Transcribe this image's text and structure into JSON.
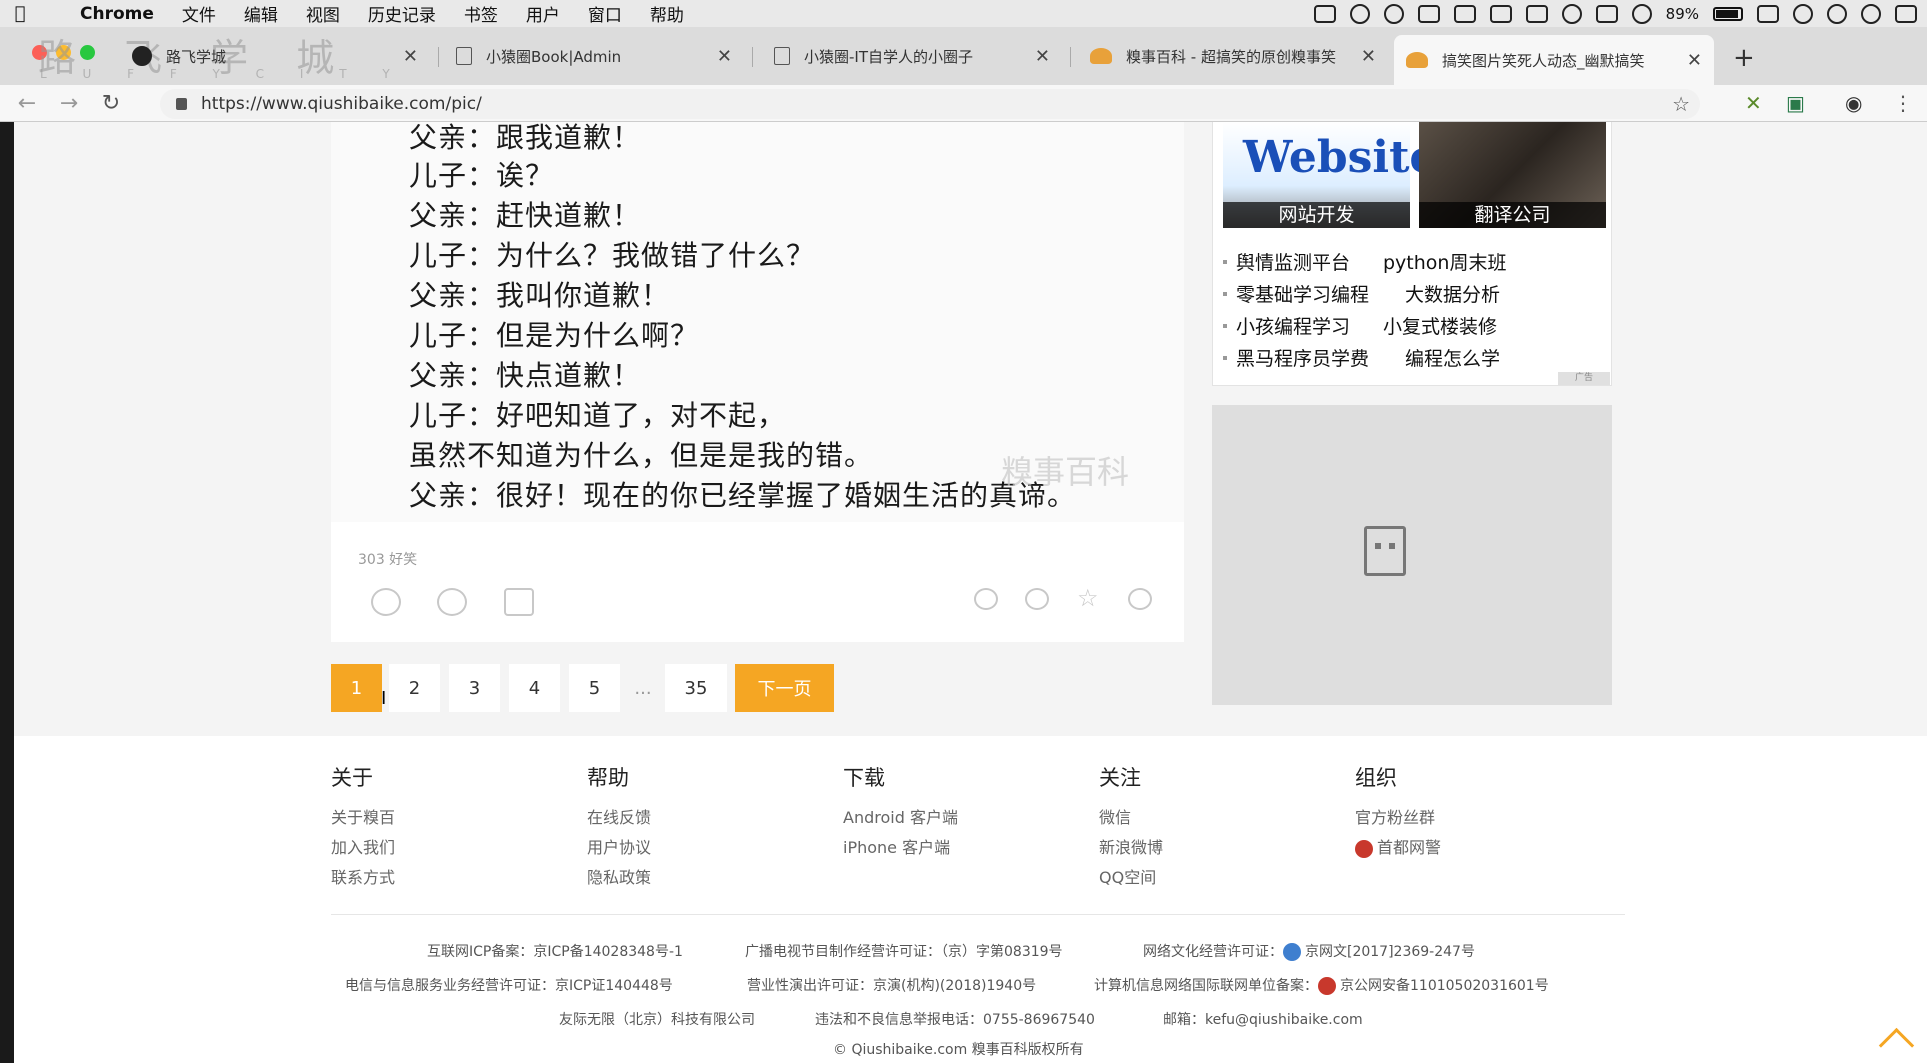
{
  "menubar": {
    "items": [
      "Chrome",
      "文件",
      "编辑",
      "视图",
      "历史记录",
      "书签",
      "用户",
      "窗口",
      "帮助"
    ],
    "battery": "89%"
  },
  "browser": {
    "watermark": "路 飞 学 城",
    "watermark_sub": "L U F F Y C I T Y",
    "tabs": [
      {
        "title": "路飞学城"
      },
      {
        "title": "小猿圈Book|Admin"
      },
      {
        "title": "小猿圈-IT自学人的小圈子"
      },
      {
        "title": "糗事百科 - 超搞笑的原创糗事笑"
      },
      {
        "title": "搞笑图片笑死人动态_幽默搞笑"
      }
    ],
    "new_tab": "+",
    "url": "https://www.qiushibaike.com/pic/"
  },
  "post": {
    "lines": [
      "父亲：跟我道歉！",
      "儿子：诶？",
      "父亲：赶快道歉！",
      "儿子：为什么？我做错了什么？",
      "父亲：我叫你道歉！",
      "儿子：但是为什么啊？",
      "父亲：快点道歉！",
      "儿子：好吧知道了，对不起，",
      "虽然不知道为什么，但是是我的错。",
      "父亲：很好！现在的你已经掌握了婚姻生活的真谛。"
    ],
    "image_watermark": "糗事百科",
    "votes": "303 好笑"
  },
  "pagination": {
    "pages": [
      "1",
      "2",
      "3",
      "4",
      "5"
    ],
    "ellipsis": "...",
    "last": "35",
    "next": "下一页"
  },
  "sidebar": {
    "ad_images": [
      {
        "logo": "Website",
        "caption": "网站开发"
      },
      {
        "caption": "翻译公司"
      }
    ],
    "ad_links": [
      [
        "舆情监测平台",
        "python周末班"
      ],
      [
        "零基础学习编程",
        "大数据分析"
      ],
      [
        "小孩编程学习",
        "小复式楼装修"
      ],
      [
        "黑马程序员学费",
        "编程怎么学"
      ]
    ],
    "ad_tag": "广告"
  },
  "footer": {
    "columns": [
      {
        "title": "关于",
        "links": [
          "关于糗百",
          "加入我们",
          "联系方式"
        ]
      },
      {
        "title": "帮助",
        "links": [
          "在线反馈",
          "用户协议",
          "隐私政策"
        ]
      },
      {
        "title": "下载",
        "links": [
          "Android 客户端",
          "iPhone 客户端"
        ]
      },
      {
        "title": "关注",
        "links": [
          "微信",
          "新浪微博",
          "QQ空间"
        ]
      },
      {
        "title": "组织",
        "links": [
          "官方粉丝群",
          "首都网警"
        ]
      }
    ],
    "legal": {
      "icp": "互联网ICP备案：京ICP备14028348号-1",
      "broadcast": "广播电视节目制作经营许可证：（京）字第08319号",
      "culture": "网络文化经营许可证：",
      "culture_no": "京网文[2017]2369-247号",
      "telecom": "电信与信息服务业务经营许可证：京ICP证140448号",
      "show": "营业性演出许可证：京演(机构)(2018)1940号",
      "security": "计算机信息网络国际联网单位备案：",
      "security_no": "京公网安备11010502031601号",
      "company": "友际无限（北京）科技有限公司",
      "report": "违法和不良信息举报电话：0755-86967540",
      "email": "邮箱：kefu@qiushibaike.com",
      "copyright": "© Qiushibaike.com 糗事百科版权所有"
    }
  },
  "colors": {
    "accent": "#f5a623",
    "page_bg": "#f4f4f4"
  }
}
